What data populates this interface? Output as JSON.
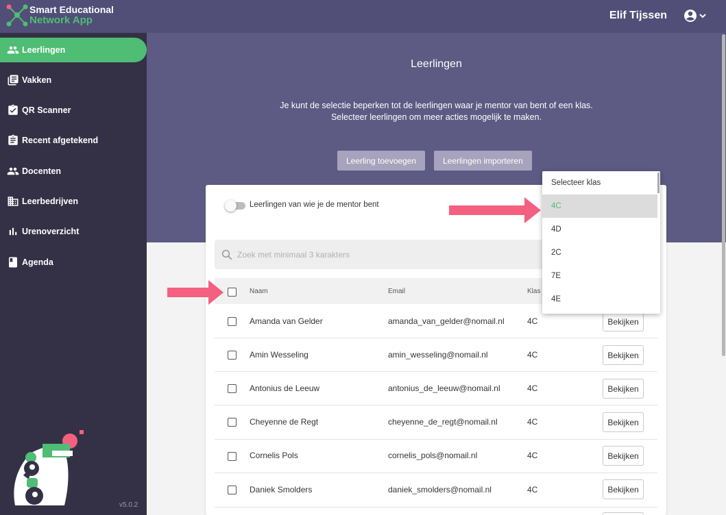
{
  "app": {
    "name_line1": "Smart Educational",
    "name_line2": "Network App",
    "user_name": "Elif Tijssen",
    "version": "v5.0.2"
  },
  "sidebar": {
    "items": [
      {
        "label": "Leerlingen",
        "icon": "people-icon",
        "active": true
      },
      {
        "label": "Vakken",
        "icon": "library-books-icon"
      },
      {
        "label": "QR Scanner",
        "icon": "clipboard-check-icon"
      },
      {
        "label": "Recent afgetekend",
        "icon": "assignment-icon"
      },
      {
        "label": "Docenten",
        "icon": "people-icon"
      },
      {
        "label": "Leerbedrijven",
        "icon": "business-icon"
      },
      {
        "label": "Urenoverzicht",
        "icon": "bar-chart-icon"
      },
      {
        "label": "Agenda",
        "icon": "book-icon"
      }
    ]
  },
  "page": {
    "title": "Leerlingen",
    "intro_line1": "Je kunt de selectie beperken tot de leerlingen waar je mentor van bent of een klas.",
    "intro_line2": "Selecteer leerlingen om meer acties mogelijk te maken.",
    "add_button": "Leerling toevoegen",
    "import_button": "Leerlingen importeren"
  },
  "filters": {
    "mentor_toggle_label": "Leerlingen van wie je de mentor bent",
    "mentor_toggle_on": false,
    "search_placeholder": "Zoek met minimaal 3 karakters"
  },
  "class_dropdown": {
    "options": [
      "Selecteer klas",
      "4C",
      "4D",
      "2C",
      "7E",
      "4E"
    ],
    "selected": "4C"
  },
  "table": {
    "headers": {
      "name": "Naam",
      "email": "Email",
      "class": "Klas"
    },
    "view_label": "Bekijken",
    "rows": [
      {
        "name": "Amanda van Gelder",
        "email": "amanda_van_gelder@nomail.nl",
        "class": "4C"
      },
      {
        "name": "Amin Wesseling",
        "email": "amin_wesseling@nomail.nl",
        "class": "4C"
      },
      {
        "name": "Antonius de Leeuw",
        "email": "antonius_de_leeuw@nomail.nl",
        "class": "4C"
      },
      {
        "name": "Cheyenne de Regt",
        "email": "cheyenne_de_regt@nomail.nl",
        "class": "4C"
      },
      {
        "name": "Cornelis Pols",
        "email": "cornelis_pols@nomail.nl",
        "class": "4C"
      },
      {
        "name": "Daniek Smolders",
        "email": "daniek_smolders@nomail.nl",
        "class": "4C"
      }
    ]
  },
  "colors": {
    "header": "#514e78",
    "sidebar": "#343146",
    "accent_green": "#4fbd73",
    "hero": "#5d5a84",
    "arrow_pink": "#f4607f"
  }
}
